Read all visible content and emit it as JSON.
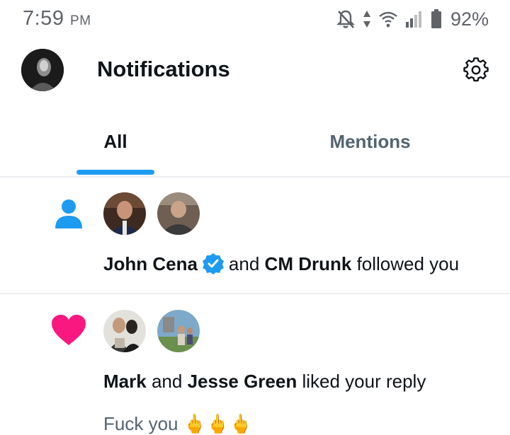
{
  "status_bar": {
    "time": "7:59",
    "ampm": "PM",
    "battery": "92%",
    "icons": [
      "bell-muted-icon",
      "data-arrows-icon",
      "wifi-icon",
      "signal-icon",
      "battery-icon"
    ]
  },
  "header": {
    "title": "Notifications",
    "icons": [
      "avatar",
      "gear-icon"
    ]
  },
  "tabs": [
    {
      "label": "All",
      "selected": true
    },
    {
      "label": "Mentions",
      "selected": false
    }
  ],
  "notifications": [
    {
      "type_icon": "person-icon",
      "name1": "John Cena",
      "verified": true,
      "connector": "and",
      "name2": "CM Drunk",
      "action": "followed you"
    },
    {
      "type_icon": "heart-icon",
      "name1": "Mark",
      "connector": "and",
      "name2": "Jesse Green",
      "action": "liked your reply",
      "preview": "Fuck you 🖕🖕🖕"
    }
  ],
  "colors": {
    "accent": "#1d9bf0",
    "like": "#f91880",
    "text": "#0f1419",
    "secondary": "#536471"
  }
}
